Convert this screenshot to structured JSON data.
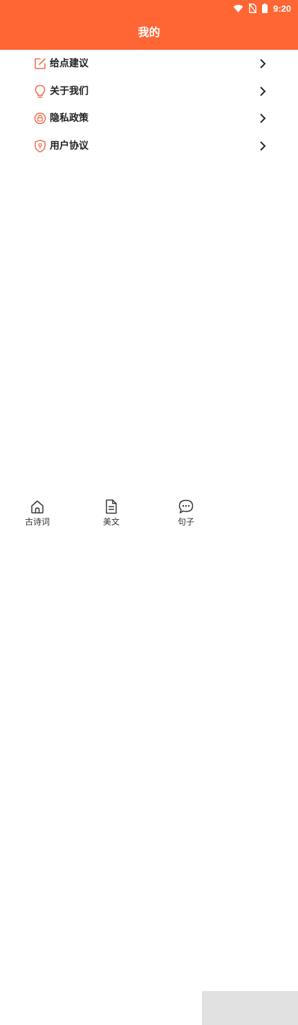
{
  "status_bar": {
    "time": "9:20",
    "icons": [
      "wifi-icon",
      "no-sim-icon",
      "battery-icon"
    ]
  },
  "header": {
    "title": "我的"
  },
  "menu": {
    "items": [
      {
        "label": "给点建议",
        "icon": "edit-icon"
      },
      {
        "label": "关于我们",
        "icon": "lightbulb-icon"
      },
      {
        "label": "隐私政策",
        "icon": "lock-icon"
      },
      {
        "label": "用户协议",
        "icon": "shield-icon"
      }
    ]
  },
  "bottom_nav": {
    "items": [
      {
        "label": "古诗词",
        "icon": "home-icon"
      },
      {
        "label": "美文",
        "icon": "document-icon"
      },
      {
        "label": "句子",
        "icon": "chat-bubble-icon"
      }
    ]
  },
  "colors": {
    "accent": "#FF6633",
    "icon_accent": "#F26B4F",
    "text": "#222222"
  }
}
